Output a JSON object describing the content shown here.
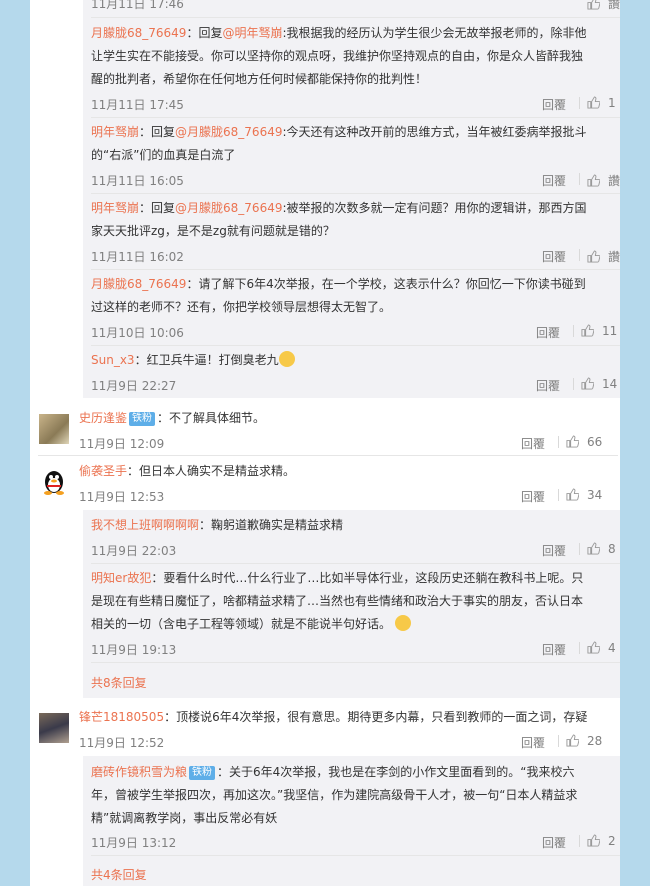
{
  "reply_label": "回覆",
  "more_replies_1": "共8条回复",
  "more_replies_2": "共4条回复",
  "top": {
    "time": "11月11日 17:46",
    "like": "讚"
  },
  "sub1": [
    {
      "user": "月朦胧68_76649",
      "pre": "：回复",
      "at": "@明年驽崩",
      "body1": ":我根据我的经历认为学生很少会无故举报老师的，除非他",
      "body2": "让学生实在不能接受。你可以坚持你的观点呀，我维护你坚持观点的自由，你是众人皆醉我独",
      "body3": "醒的批判者，希望你在任何地方任何时候都能保持你的批判性！",
      "time": "11月11日 17:45",
      "like": "1"
    },
    {
      "user": "明年驽崩",
      "pre": "：回复",
      "at": "@月朦胧68_76649",
      "body1": ":今天还有这种改开前的思维方式，当年被红委病举报批斗",
      "body2": "的“右派”们的血真是白流了",
      "time": "11月11日 16:05",
      "like": "讚"
    },
    {
      "user": "明年驽崩",
      "pre": "：回复",
      "at": "@月朦胧68_76649",
      "body1": ":被举报的次数多就一定有问题？用你的逻辑讲，那西方国",
      "body2": "家天天批评zg，是不是zg就有问题就是错的？",
      "time": "11月11日 16:02",
      "like": "讚"
    },
    {
      "user": "月朦胧68_76649",
      "body1": "：请了解下6年4次举报，在一个学校，这表示什么？你回忆一下你读书碰到",
      "body2": "过这样的老师不？还有，你把学校领导层想得太无智了。",
      "time": "11月10日 10:06",
      "like": "11"
    },
    {
      "user": "Sun_x3",
      "body1": "：红卫兵牛逼！打倒臭老九",
      "time": "11月9日 22:27",
      "like": "14"
    }
  ],
  "c1": {
    "user": "史历逢鉴",
    "badge": "铁粉",
    "body": "：不了解具体细节。",
    "time": "11月9日 12:09",
    "like": "66"
  },
  "c2": {
    "user": "偷袭圣手",
    "body": "：但日本人确实不是精益求精。",
    "time": "11月9日 12:53",
    "like": "34"
  },
  "sub2": [
    {
      "user": "我不想上班啊啊啊啊",
      "body1": "：鞠躬道歉确实是精益求精",
      "time": "11月9日 22:03",
      "like": "8"
    },
    {
      "user": "明知er故犯",
      "body1": "：要看什么时代…什么行业了…比如半导体行业，这段历史还躺在教科书上呢。只",
      "body2": "是现在有些精日魔怔了，啥都精益求精了…当然也有些情绪和政治大于事实的朋友，否认日本",
      "body3": "相关的一切（含电子工程等领域）就是不能说半句好话。",
      "time": "11月9日 19:13",
      "like": "4"
    }
  ],
  "c3": {
    "user": "锋芒18180505",
    "body": "：顶楼说6年4次举报，很有意思。期待更多内幕，只看到教师的一面之词，存疑",
    "time": "11月9日 12:52",
    "like": "28"
  },
  "sub3": [
    {
      "user": "磨砖作镜积雪为粮",
      "badge": "铁粉",
      "body1": "：关于6年4次举报，我也是在李剑的小作文里面看到的。“我来校六",
      "body2": "年，曾被学生举报四次，再加这次。”我坚信，作为建院高级骨干人才，被一句“日本人精益求",
      "body3": "精”就调离教学岗，事出反常必有妖",
      "time": "11月9日 13:12",
      "like": "2"
    }
  ]
}
